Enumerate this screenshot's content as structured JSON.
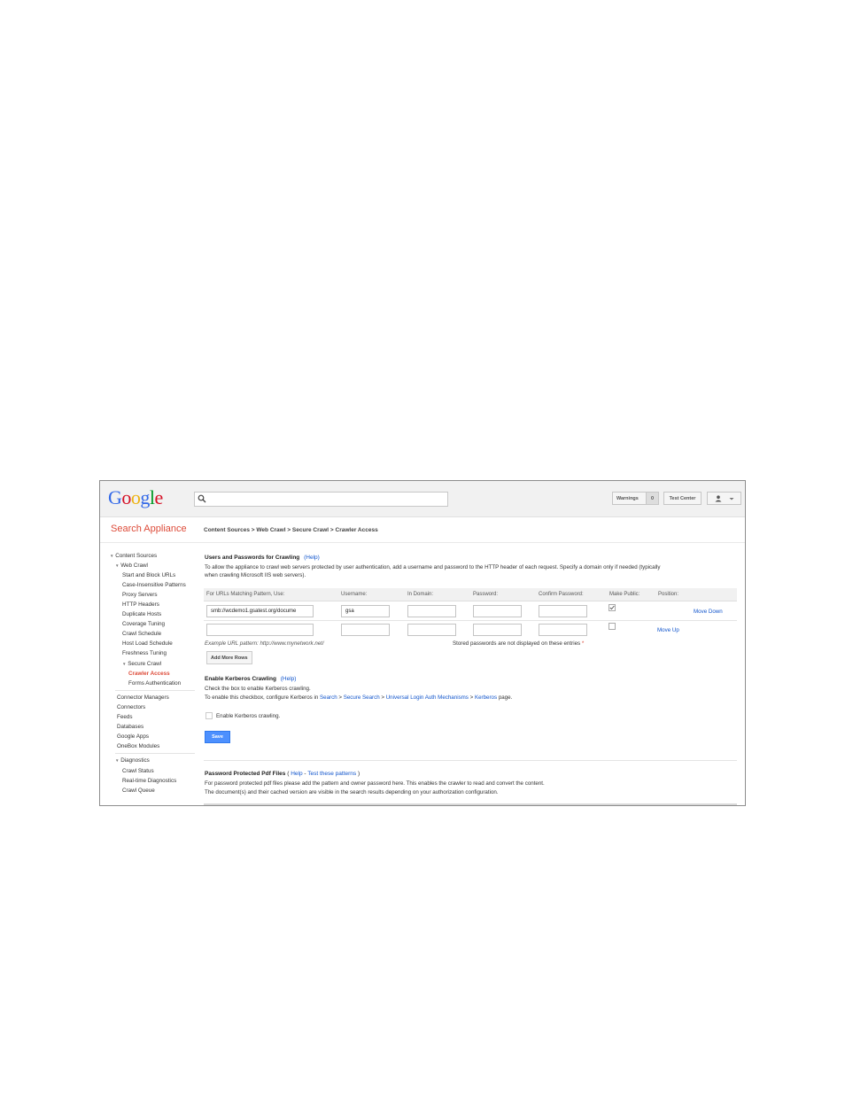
{
  "header": {
    "logo": "Google",
    "search_placeholder": "",
    "warnings_label": "Warnings",
    "warnings_count": "0",
    "test_center_label": "Test Center"
  },
  "subheader": {
    "app_title": "Search Appliance",
    "breadcrumb": "Content Sources > Web Crawl > Secure Crawl > Crawler Access"
  },
  "sidebar": {
    "content_sources": "Content Sources",
    "web_crawl": "Web Crawl",
    "web_crawl_items": [
      "Start and Block URLs",
      "Case-Insensitive Patterns",
      "Proxy Servers",
      "HTTP Headers",
      "Duplicate Hosts",
      "Coverage Tuning",
      "Crawl Schedule",
      "Host Load Schedule",
      "Freshness Tuning"
    ],
    "secure_crawl": "Secure Crawl",
    "secure_crawl_items": [
      "Crawler Access",
      "Forms Authentication"
    ],
    "other_items": [
      "Connector Managers",
      "Connectors",
      "Feeds",
      "Databases",
      "Google Apps",
      "OneBox Modules"
    ],
    "diagnostics": "Diagnostics",
    "diagnostics_items": [
      "Crawl Status",
      "Real-time Diagnostics",
      "Crawl Queue"
    ]
  },
  "users_section": {
    "title": "Users and Passwords for Crawling",
    "help": "(Help)",
    "desc_line1": "To allow the appliance to crawl web servers protected by user authentication, add a username and password to the HTTP header of each request. Specify a domain only if needed (typically",
    "desc_line2": "when crawling Microsoft IIS web servers).",
    "columns": [
      "For URLs Matching Pattern, Use:",
      "Username:",
      "In Domain:",
      "Password:",
      "Confirm Password:",
      "Make Public:",
      "Position:"
    ],
    "rows": [
      {
        "pattern": "smb://wcdemo1.gsatest.org/docume",
        "username": "gsa",
        "domain": "",
        "password": "",
        "confirm": "",
        "make_public": true,
        "position": "Move Down"
      },
      {
        "pattern": "",
        "username": "",
        "domain": "",
        "password": "",
        "confirm": "",
        "make_public": false,
        "position": "Move Up"
      }
    ],
    "example": "Example URL pattern: http://www.mynetwork.net/",
    "stored_note": "Stored passwords are not displayed on these entries",
    "required_mark": "*",
    "add_rows": "Add More Rows"
  },
  "kerberos_section": {
    "title": "Enable Kerberos Crawling",
    "help": "(Help)",
    "line1": "Check the box to enable Kerberos crawling.",
    "line2_prefix": "To enable this checkbox, configure Kerberos in",
    "line2_links": [
      "Search",
      "Secure Search",
      "Universal Login Auth Mechanisms",
      "Kerberos"
    ],
    "line2_suffix": "page.",
    "checkbox_label": "Enable Kerberos crawling.",
    "save": "Save"
  },
  "pdf_section": {
    "title": "Password Protected Pdf Files",
    "help": "Help",
    "test": "Test these patterns",
    "line1": "For password protected pdf files please add the pattern and owner password here. This enables the crawler to read and convert the content.",
    "line2": "The document(s) and their cached version are visible in the search results depending on your authorization configuration."
  },
  "colors": {
    "accent_red": "#dd4b39",
    "link_blue": "#1155cc",
    "save_blue": "#4d90fe"
  }
}
